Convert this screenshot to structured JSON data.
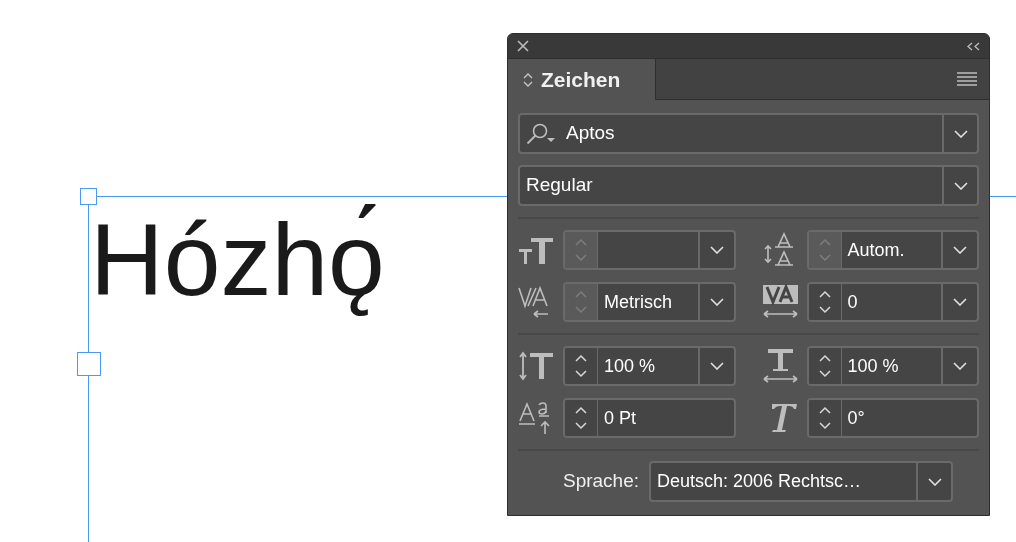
{
  "canvas": {
    "text": "Hózhǫ́"
  },
  "panel": {
    "tab": {
      "label": "Zeichen",
      "selected": true
    },
    "font_family": {
      "value": "Aptos"
    },
    "font_style": {
      "value": "Regular"
    },
    "field_groups": [
      [
        {
          "kind": "combo",
          "disabled": true
        },
        {
          "kind": "combo",
          "value": "Autom.",
          "disabled": true
        },
        {
          "kind": "combo",
          "value": "Metrisch",
          "disabled": true
        },
        {
          "kind": "combo",
          "value": "0",
          "disabled": false
        }
      ],
      [
        {
          "kind": "combo",
          "value": "100 %",
          "disabled": false
        },
        {
          "kind": "combo",
          "value": "100 %",
          "disabled": false
        },
        {
          "kind": "spin",
          "value": "0 Pt",
          "disabled": false
        },
        {
          "kind": "spin",
          "value": "0°",
          "disabled": false
        }
      ]
    ],
    "language": {
      "label": "Sprache:",
      "value": "Deutsch: 2006 Rechtsc…"
    }
  }
}
